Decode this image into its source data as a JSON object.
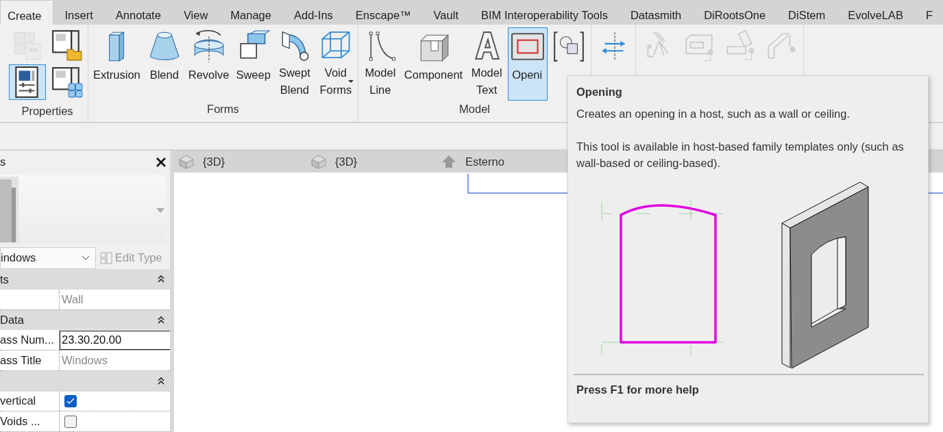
{
  "ribbon_tabs": [
    {
      "label": "Create",
      "selected": true
    },
    {
      "label": "Insert",
      "selected": false
    },
    {
      "label": "Annotate",
      "selected": false
    },
    {
      "label": "View",
      "selected": false
    },
    {
      "label": "Manage",
      "selected": false
    },
    {
      "label": "Add-Ins",
      "selected": false
    },
    {
      "label": "Enscape™",
      "selected": false
    },
    {
      "label": "Vault",
      "selected": false
    },
    {
      "label": "BIM Interoperability Tools",
      "selected": false
    },
    {
      "label": "Datasmith",
      "selected": false
    },
    {
      "label": "DiRootsOne",
      "selected": false
    },
    {
      "label": "DiStem",
      "selected": false
    },
    {
      "label": "EvolveLAB",
      "selected": false
    },
    {
      "label": "F",
      "selected": false
    }
  ],
  "ribbon_panels": [
    {
      "label": "Properties",
      "tools": [
        {
          "kind": "familytypes",
          "selected": false,
          "disabled": true
        },
        {
          "kind": "loadfamily",
          "selected": false,
          "disabled": false
        },
        {
          "kind": "properties",
          "selected": true,
          "disabled": false
        },
        {
          "kind": "category",
          "selected": false,
          "disabled": false
        }
      ]
    },
    {
      "label": "Forms",
      "tools": [
        {
          "kind": "extrusion",
          "label": "Extrusion",
          "selected": false,
          "disabled": false
        },
        {
          "kind": "blend",
          "label": "Blend",
          "selected": false,
          "disabled": false
        },
        {
          "kind": "revolve",
          "label": "Revolve",
          "selected": false,
          "disabled": false
        },
        {
          "kind": "sweep",
          "label": "Sweep",
          "selected": false,
          "disabled": false
        },
        {
          "kind": "sweptblend",
          "label": "Swept Blend",
          "selected": false,
          "disabled": false
        },
        {
          "kind": "voidforms",
          "label": "Void Forms",
          "selected": false,
          "disabled": false
        }
      ]
    },
    {
      "label": "Model",
      "tools": [
        {
          "kind": "modelline",
          "label": "Model Line",
          "selected": false,
          "disabled": false
        },
        {
          "kind": "component",
          "label": "Component",
          "selected": false,
          "disabled": false
        },
        {
          "kind": "modeltext",
          "label": "Model Text",
          "selected": false,
          "disabled": false
        },
        {
          "kind": "opening",
          "label": "Openi",
          "selected": true,
          "disabled": false
        },
        {
          "kind": "modelgroup",
          "selected": false,
          "disabled": false
        }
      ]
    },
    {
      "tools": [
        {
          "kind": "control",
          "selected": false,
          "disabled": false
        }
      ]
    },
    {
      "tools": [
        {
          "kind": "electrical",
          "selected": false,
          "disabled": true
        },
        {
          "kind": "duct",
          "selected": false,
          "disabled": true
        },
        {
          "kind": "pipe",
          "selected": false,
          "disabled": true
        },
        {
          "kind": "cabletray",
          "selected": false,
          "disabled": true
        }
      ]
    }
  ],
  "properties_palette": {
    "title": "s",
    "type_selector": "indows",
    "edit_type": {
      "label": "Edit Type",
      "disabled": true
    },
    "groups": [
      {
        "title": "ts",
        "expanded": true,
        "rows": [
          {
            "kind": "readonly",
            "value": "Wall"
          }
        ]
      },
      {
        "title": "Data",
        "expanded": true,
        "rows": [
          {
            "kind": "input",
            "name": "ass Num...",
            "value": "23.30.20.00"
          },
          {
            "kind": "readonly",
            "name": "ass Title",
            "value": "Windows"
          }
        ]
      },
      {
        "expanded": true,
        "rows": [
          {
            "kind": "checkbox",
            "name": "vertical",
            "checked": true
          },
          {
            "kind": "checkbox",
            "name": "Voids ...",
            "checked": false
          }
        ]
      }
    ]
  },
  "view_tabs": [
    {
      "label": "{3D}",
      "kind": "threed"
    },
    {
      "label": "{3D}",
      "kind": "threed"
    },
    {
      "label": "Esterno",
      "kind": "elevation"
    }
  ],
  "tooltip": {
    "title": "Opening",
    "description": "Creates an opening in a host, such as a wall or ceiling.",
    "note": "This tool is available in host-based family templates only (such as wall-based or ceiling-based).",
    "footer": "Press F1 for more help"
  }
}
